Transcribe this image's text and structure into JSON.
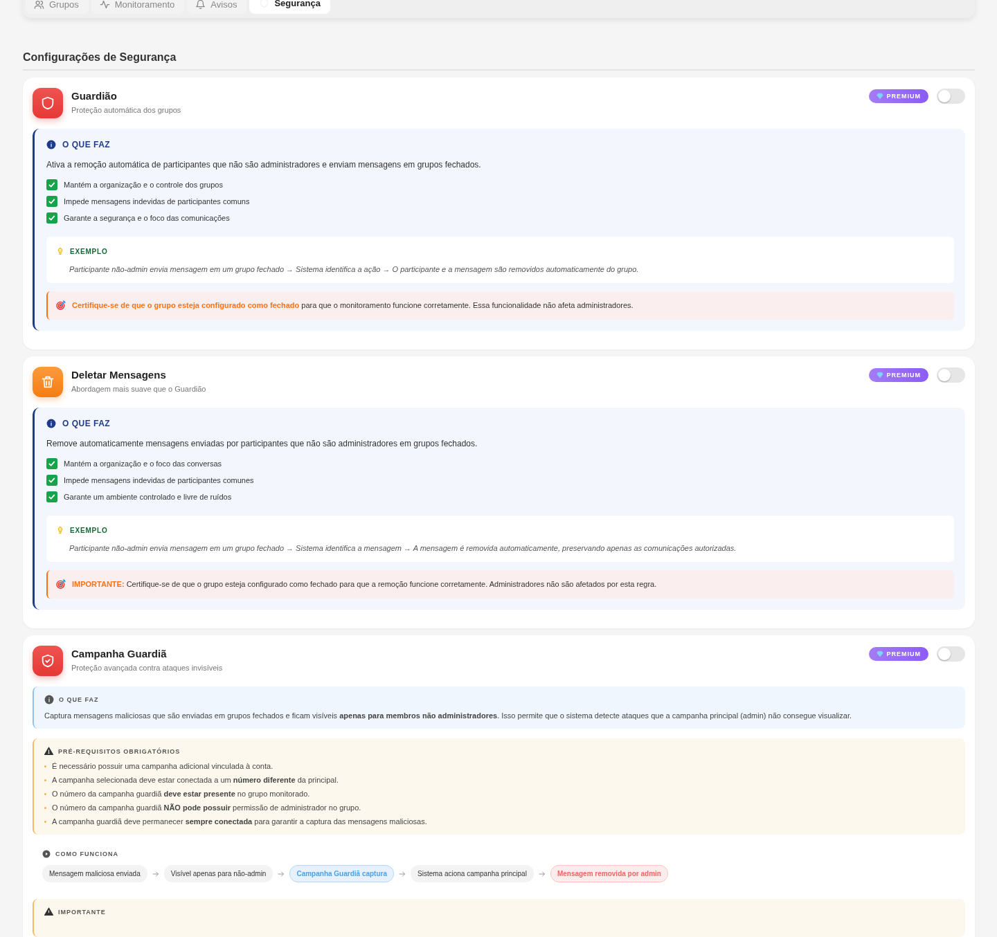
{
  "tabs": [
    {
      "label": "Grupos",
      "selected": false
    },
    {
      "label": "Monitoramento",
      "selected": false
    },
    {
      "label": "Avisos",
      "selected": false
    },
    {
      "label": "Segurança",
      "selected": true
    }
  ],
  "section_title": "Configurações de Segurança",
  "features": [
    {
      "kind": "standard",
      "title": "Guardião",
      "subtitle": "Proteção automática dos grupos",
      "badge": "PREMIUM",
      "on": false,
      "what": {
        "heading": "O QUE FAZ",
        "text": "Ativa a remoção automática de participantes que não são administradores e enviam mensagens em grupos fechados.",
        "checks": [
          "Mantém a organização e o controle dos grupos",
          "Impede mensagens indevidas de participantes comuns",
          "Garante a segurança e o foco das comunicações"
        ]
      },
      "example": {
        "heading": "EXEMPLO",
        "text": "Participante não-admin envia mensagem em um grupo fechado → Sistema identifica a ação → O participante e a mensagem são removidos automaticamente do grupo."
      },
      "note": "**Certifique-se de que o grupo esteja configurado como fechado** para que o monitoramento funcione corretamente. Essa funcionalidade não afeta administradores."
    },
    {
      "kind": "standard",
      "title": "Deletar Mensagens",
      "subtitle": "Abordagem mais suave que o Guardião",
      "badge": "PREMIUM",
      "on": false,
      "what": {
        "heading": "O QUE FAZ",
        "text": "Remove automaticamente mensagens enviadas por participantes que não são administradores em grupos fechados.",
        "checks": [
          "Mantém a organização e o foco das conversas",
          "Impede mensagens indevidas de participantes comunes",
          "Garante um ambiente controlado e livre de ruídos"
        ]
      },
      "example": {
        "heading": "EXEMPLO",
        "text": "Participante não-admin envia mensagem em um grupo fechado → Sistema identifica a mensagem → A mensagem é removida automaticamente, preservando apenas as comunicações autorizadas."
      },
      "note": "**IMPORTANTE:** Certifique-se de que o grupo esteja configurado como fechado para que a remoção funcione corretamente. Administradores não são afetados por esta regra."
    },
    {
      "kind": "campaign",
      "title": "Campanha Guardiã",
      "subtitle": "Proteção avançada contra ataques invisíveis",
      "badge": "PREMIUM",
      "on": false,
      "what": {
        "heading": "O QUE FAZ",
        "text": "Captura mensagens maliciosas que são enviadas em grupos fechados e ficam visíveis **apenas para membros não administradores**. Isso permite que o sistema detecte ataques que a campanha principal (admin) não consegue visualizar."
      },
      "prereqs": {
        "heading": "PRÉ-REQUISITOS OBRIGATÓRIOS",
        "items": [
          "É necessário possuir uma campanha adicional vinculada à conta.",
          "A campanha selecionada deve estar conectada a um **número diferente** da principal.",
          "O número da campanha guardiã **deve estar presente** no grupo monitorado.",
          "O número da campanha guardiã **NÃO pode possuir** permissão de administrador no grupo.",
          "A campanha guardiã deve permanecer **sempre conectada** para garantir a captura das mensagens maliciosas."
        ]
      },
      "how": {
        "heading": "COMO FUNCIONA",
        "steps": [
          {
            "label": "Mensagem maliciosa enviada",
            "kind": "neutral"
          },
          {
            "label": "Visível apenas para não-admin",
            "kind": "neutral"
          },
          {
            "label": "Campanha Guardiã captura",
            "kind": "info"
          },
          {
            "label": "Sistema aciona campanha principal",
            "kind": "neutral"
          },
          {
            "label": "Mensagem removida por admin",
            "kind": "danger"
          }
        ]
      },
      "important": {
        "heading": "IMPORTANTE"
      }
    }
  ]
}
